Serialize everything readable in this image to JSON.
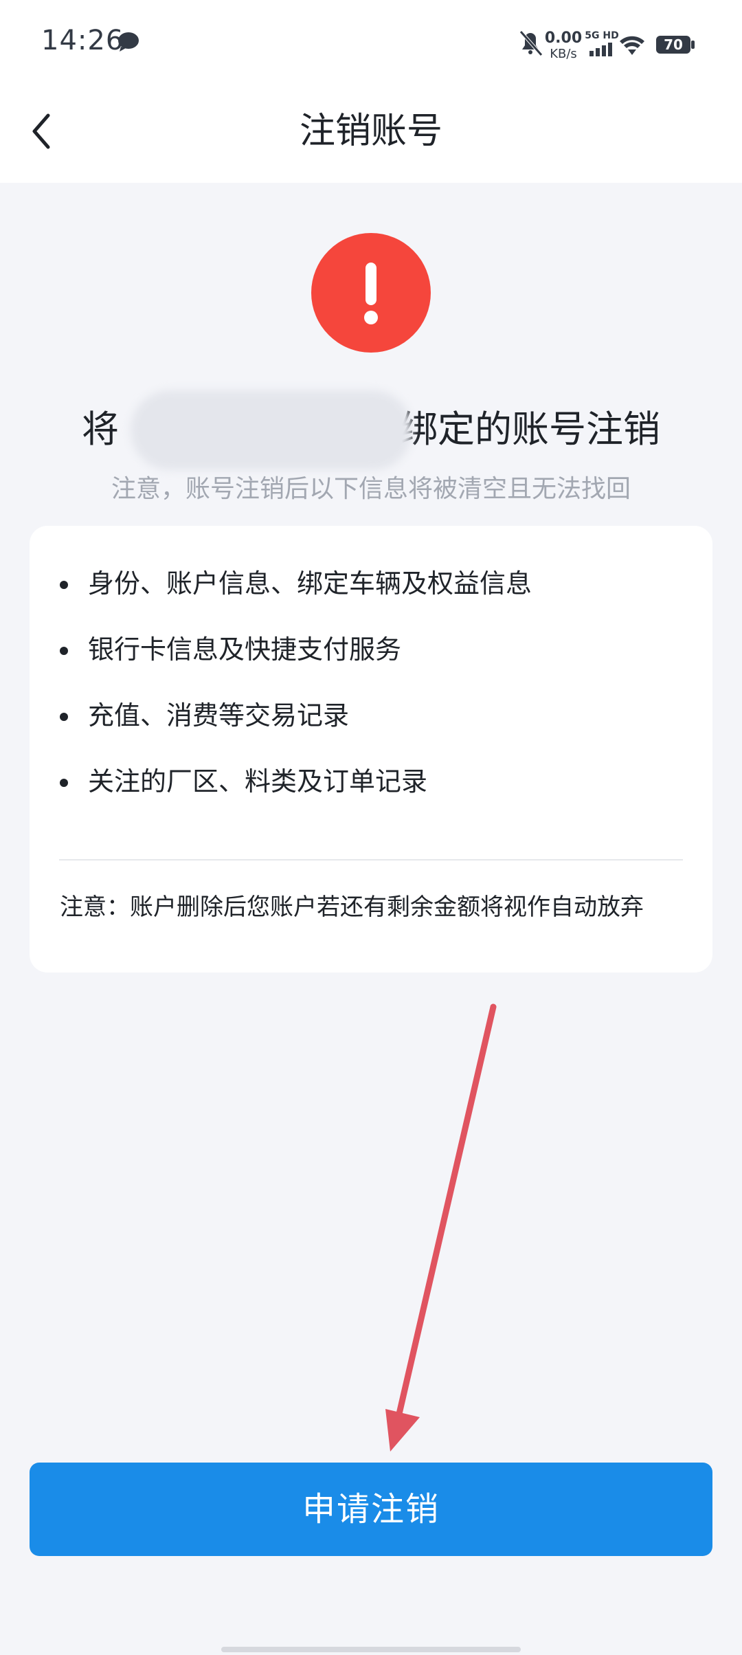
{
  "status_bar": {
    "time": "14:26",
    "net_speed_value": "0.00",
    "net_speed_unit": "KB/s",
    "network_label": "5G HD",
    "battery": "70"
  },
  "nav": {
    "title": "注销账号"
  },
  "warning": {
    "headline_prefix": "将",
    "headline_suffix": "绑定的账号注销",
    "subtitle": "注意，账号注销后以下信息将被清空且无法找回"
  },
  "info_card": {
    "items": [
      "身份、账户信息、绑定车辆及权益信息",
      "银行卡信息及快捷支付服务",
      "充值、消费等交易记录",
      "关注的厂区、料类及订单记录"
    ],
    "note": "注意：账户删除后您账户若还有剩余金额将视作自动放弃"
  },
  "action": {
    "apply_label": "申请注销"
  },
  "colors": {
    "accent": "#1a8ce8",
    "warning": "#f5463c",
    "annotation": "#e05460"
  }
}
